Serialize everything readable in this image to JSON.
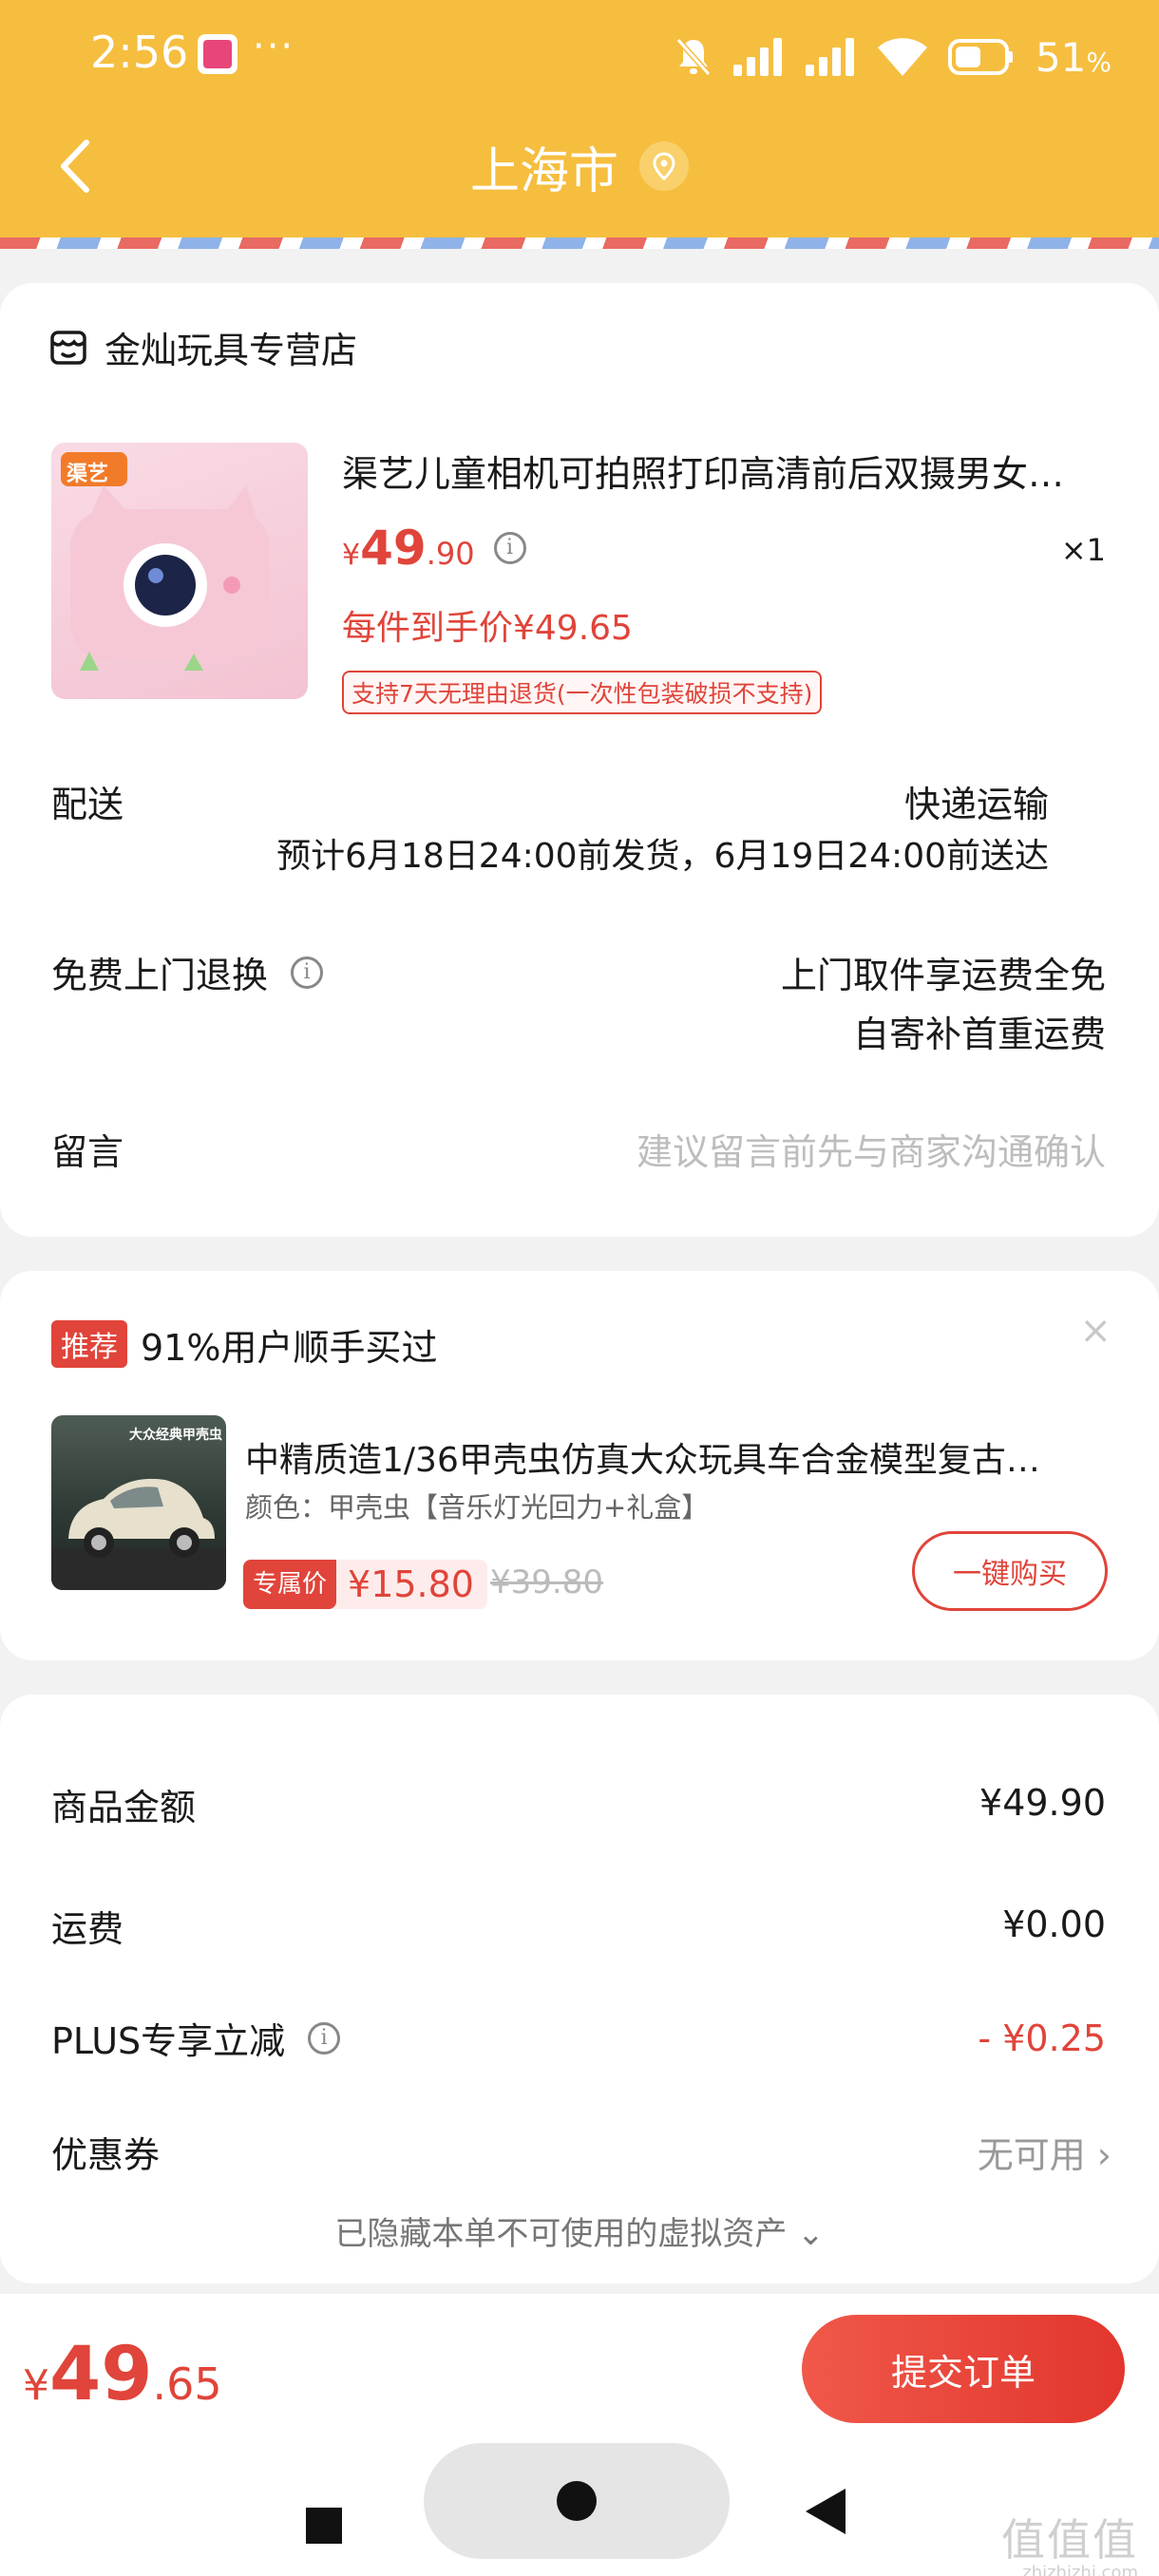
{
  "status_bar": {
    "time": "2:56",
    "dots": "···",
    "battery": "51",
    "battery_unit": "%"
  },
  "header": {
    "title": "上海市"
  },
  "order": {
    "store_name": "金灿玩具专营店",
    "product": {
      "title": "渠艺儿童相机可拍照打印高清前后双摄男女…",
      "price_currency": "¥",
      "price_int": "49",
      "price_dec": ".90",
      "quantity": "×1",
      "final_price": "每件到手价¥49.65",
      "return_policy": "支持7天无理由退货(一次性包装破损不支持)",
      "image_badge": "渠艺"
    },
    "delivery": {
      "label": "配送",
      "method": "快递运输",
      "estimate": "预计6月18日24:00前发货，6月19日24:00前送达"
    },
    "free_return": {
      "label": "免费上门退换",
      "line1": "上门取件享运费全免",
      "line2": "自寄补首重运费"
    },
    "message": {
      "label": "留言",
      "placeholder": "建议留言前先与商家沟通确认"
    }
  },
  "recommend": {
    "tag": "推荐",
    "title": "91%用户顺手买过",
    "close": "×",
    "item": {
      "name": "中精质造1/36甲壳虫仿真大众玩具车合金模型复古…",
      "spec": "颜色：甲壳虫【音乐灯光回力+礼盒】",
      "exclusive_tag": "专属价",
      "price": "¥15.80",
      "original_price": "¥39.80",
      "buy_label": "一键购买",
      "image_caption": "大众经典甲壳虫"
    }
  },
  "summary": {
    "rows": [
      {
        "label": "商品金额",
        "value": "¥49.90"
      },
      {
        "label": "运费",
        "value": "¥0.00"
      },
      {
        "label": "PLUS专享立减",
        "value": "- ¥0.25"
      },
      {
        "label": "优惠券",
        "value": "无可用 ›"
      }
    ],
    "hidden_assets": "已隐藏本单不可使用的虚拟资产 ⌄"
  },
  "footer": {
    "total_currency": "¥",
    "total_int": "49",
    "total_dec": ".65",
    "submit_label": "提交订单"
  },
  "watermark": {
    "big": "值值值",
    "small": "zhizhizhi.com"
  },
  "colors": {
    "header_bg": "#f6be3f",
    "accent_red": "#e0443a"
  }
}
